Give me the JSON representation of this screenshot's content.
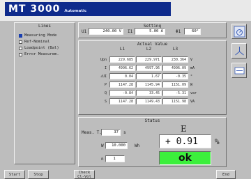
{
  "header": {
    "title": "MT 3000",
    "mode": "Automatic"
  },
  "lines": {
    "title": "Lines",
    "items": [
      {
        "label": "Measuring Mode",
        "checked": true
      },
      {
        "label": "Ref-Nominal",
        "checked": false
      },
      {
        "label": "Loadpoint (Bal)",
        "checked": false
      },
      {
        "label": "Error Measurem.",
        "checked": false
      }
    ]
  },
  "setting": {
    "title": "Setting",
    "u_label": "U1",
    "u_value": "240.00 V",
    "i_label": "I1",
    "i_value": "5.00 A",
    "phi_label": "Φ1",
    "phi_value": "60°"
  },
  "actual": {
    "title": "Actual Value",
    "columns": [
      "L1",
      "L2",
      "L3"
    ],
    "rows": [
      {
        "label": "Upn",
        "values": [
          "229.685",
          "229.971",
          "230.364"
        ],
        "unit": "V"
      },
      {
        "label": "I",
        "values": [
          "4996.62",
          "4997.96",
          "4996.09"
        ],
        "unit": "mA"
      },
      {
        "label": "∠UI",
        "values": [
          "0.04",
          "1.67",
          "-0.35"
        ],
        "unit": "°"
      },
      {
        "label": "P",
        "values": [
          "1147.28",
          "1145.94",
          "1151.09"
        ],
        "unit": "W"
      },
      {
        "label": "Q",
        "values": [
          "-0.84",
          "33.45",
          "-5.31"
        ],
        "unit": "var"
      },
      {
        "label": "S",
        "values": [
          "1147.28",
          "1149.43",
          "1151.98"
        ],
        "unit": "VA"
      }
    ]
  },
  "status": {
    "title": "Status",
    "meas_t_label": "Meas. T.",
    "meas_t_value": "37",
    "meas_t_unit": "s",
    "energy_prefix": "W",
    "energy_value": "10.000",
    "energy_unit": "Wh",
    "count_prefix": "n",
    "count_value": "1",
    "error_symbol": "E",
    "error_value": "+ 0.91",
    "error_unit": "%",
    "result": "ok"
  },
  "side_buttons": [
    {
      "label": "VALUE",
      "icon": "dial-icon"
    },
    {
      "label": "VECTOR",
      "icon": "vector-icon"
    },
    {
      "label": "ERROR",
      "icon": "error-display-icon"
    }
  ],
  "buttons": {
    "start": "Start",
    "stop": "Stop",
    "check": "Check",
    "check2": "Cl-Vol",
    "end": "End"
  },
  "colors": {
    "title_bg": "#0f2b8c",
    "ok": "#3cf03c",
    "panel": "#bdbdbd"
  }
}
